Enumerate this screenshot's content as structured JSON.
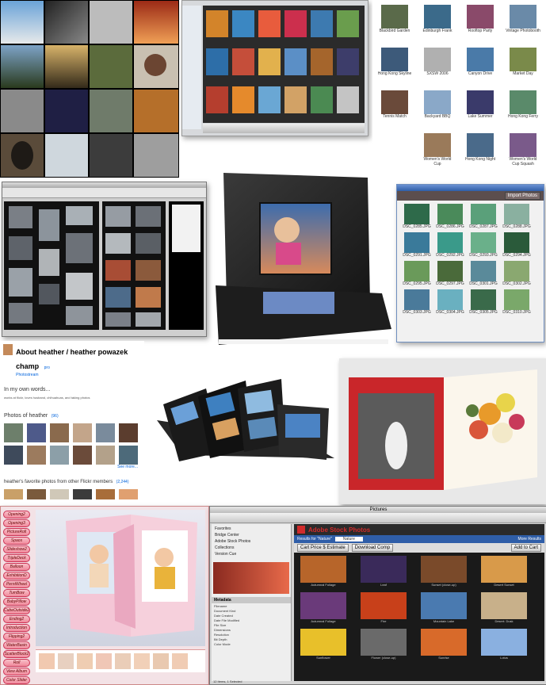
{
  "colors": {
    "dark_panel": "#1a1a1a",
    "accent_blue": "#2a5db0",
    "flickr_blue": "#0063dc",
    "pink_accent": "#e9788a",
    "adobe_red": "#d12b2b"
  },
  "flickr": {
    "title": "About heather / heather powazek champ",
    "pro_badge": "pro",
    "subtitle": "Photostream",
    "section1_heading": "In my own words...",
    "section1_text": "works at flickr, loves husband, chihuahuas, and taking photos",
    "section2_heading": "Photos of heather",
    "section2_count": "(96)",
    "see_more": "See more...",
    "section3_heading": "heather's favorite photos from other Flickr members",
    "section3_count": "(2,244)"
  },
  "import_window": {
    "import_button": "Import Photos",
    "files": [
      "DSC_0285.JPG",
      "DSC_0286.JPG",
      "DSC_0287.JPG",
      "DSC_0288.JPG",
      "DSC_0291.JPG",
      "DSC_0292.JPG",
      "DSC_0293.JPG",
      "DSC_0294.JPG",
      "DSC_0295.JPG",
      "DSC_0297.JPG",
      "DSC_0301.JPG",
      "DSC_0302.JPG",
      "DSC_0303.JPG",
      "DSC_0304.JPG",
      "DSC_0305.JPG",
      "DSC_0310.JPG"
    ]
  },
  "album_maker": {
    "buttons": [
      "Opening2",
      "Opening3",
      "PictureRoll",
      "Spaos",
      "Slideshow2",
      "TripleDeck",
      "Balloon",
      "ExhibitionD",
      "PerntWheel",
      "TumBow",
      "BabyPillow",
      "CubeOutside2",
      "Ending2",
      "Introduction",
      "Flipping2",
      "WaterBasin",
      "ScatterBlock2",
      "Roll",
      "View Album",
      "Color Slider"
    ]
  },
  "bridge": {
    "window_title": "Pictures",
    "sidebar": [
      "Favorites",
      "Bridge Center",
      "Adobe Stock Photos",
      "Collections",
      "Version Cue"
    ],
    "stock_header": "Adobe Stock Photos",
    "search_label": "Results for \"Nature\"",
    "search_placeholder": "Nature",
    "cart_button": "Cart Price $ Estimate",
    "download_button": "Download Comp",
    "add_cart_button": "Add to Cart",
    "more_results": "More Results",
    "thumbs": [
      "Autumnal Foliage",
      "Leaf",
      "Sunset (close-up)",
      "Desert Sunset",
      "Autumnal Foliage",
      "Fire",
      "Mountain Lake",
      "Desert: Dusk",
      "Sunflower",
      "Flower (close-up)",
      "Sunrise",
      "Lotus"
    ],
    "metadata_label": "Metadata",
    "metadata_rows": [
      "Filename",
      "Document Kind",
      "Date Created",
      "Date File Modified",
      "File Size",
      "Dimensions",
      "Resolution",
      "Bit Depth",
      "Color Mode"
    ],
    "status": "12 Items, 1 Selected"
  },
  "flickr_faves": {
    "items": [
      "Blackbird Garden",
      "Edinburgh Frank",
      "Rooftop Party",
      "Vintage Photobooth",
      "Hong Kong Skyline",
      "SXSW 2006",
      "Canyon Drive",
      "Market Day",
      "Tennis Match",
      "Backyard BBQ",
      "Lake Summer",
      "Hong Kong Ferry",
      "Women's World Cup",
      "Hong Kong Night",
      "Women's World Cup Squash"
    ]
  }
}
